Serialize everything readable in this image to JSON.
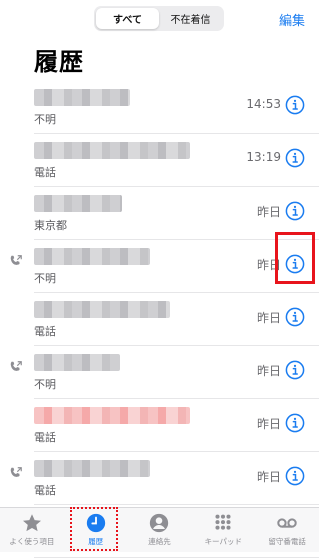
{
  "header": {
    "segments": [
      "すべて",
      "不在着信"
    ],
    "active_segment": "すべて",
    "edit_label": "編集",
    "title": "履歴"
  },
  "calls": [
    {
      "label": "不明",
      "time": "14:53",
      "outgoing": false,
      "blur": "gray",
      "blurWidth": 96
    },
    {
      "label": "電話",
      "time": "13:19",
      "outgoing": false,
      "blur": "gray",
      "blurWidth": 156
    },
    {
      "label": "東京都",
      "time": "昨日",
      "outgoing": false,
      "blur": "gray",
      "blurWidth": 88
    },
    {
      "label": "不明",
      "time": "昨日",
      "outgoing": true,
      "blur": "gray",
      "blurWidth": 116
    },
    {
      "label": "電話",
      "time": "昨日",
      "outgoing": false,
      "blur": "gray",
      "blurWidth": 136
    },
    {
      "label": "不明",
      "time": "昨日",
      "outgoing": true,
      "blur": "gray",
      "blurWidth": 86
    },
    {
      "label": "電話",
      "time": "昨日",
      "outgoing": false,
      "blur": "red",
      "blurWidth": 156
    },
    {
      "label": "電話",
      "time": "昨日",
      "outgoing": true,
      "blur": "gray",
      "blurWidth": 116
    },
    {
      "label": "",
      "time": "",
      "outgoing": false,
      "blur": "gray",
      "blurWidth": 136
    }
  ],
  "tabbar": {
    "favorites": "よく使う項目",
    "recents": "履歴",
    "contacts": "連絡先",
    "keypad": "キーパッド",
    "voicemail": "留守番電話"
  },
  "colors": {
    "accent": "#1a7cf0",
    "annotation": "#e8141c"
  }
}
